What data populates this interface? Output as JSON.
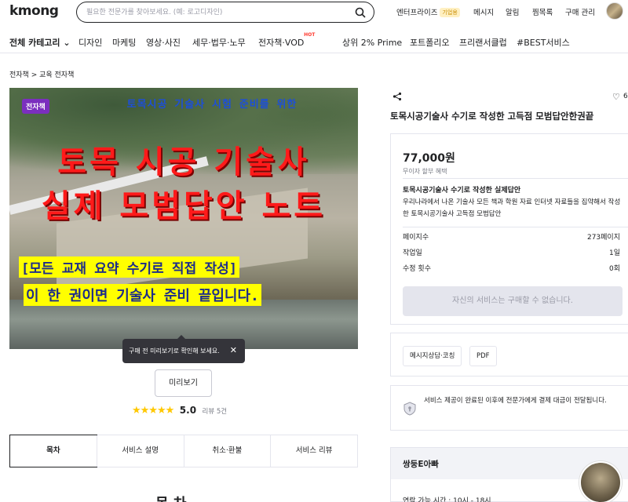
{
  "header": {
    "logo": "kmong",
    "search_placeholder": "필요한 전문가를 찾아보세요. (예: 로고디자인)",
    "menu": {
      "enterprise": "엔터프라이즈",
      "enterprise_badge": "기업용",
      "messages": "메시지",
      "notifications": "알림",
      "favorites": "찜목록",
      "purchase_manage": "구매 관리"
    }
  },
  "nav": {
    "all_categories": "전체 카테고리",
    "items": [
      "디자인",
      "마케팅",
      "영상·사진",
      "세무·법무·노무",
      "전자책·VOD",
      "상위 2% Prime",
      "포트폴리오",
      "프리랜서클럽",
      "#BEST서비스"
    ],
    "hot_label": "HOT"
  },
  "breadcrumb": "전자책 > 교육 전자책",
  "thumbnail": {
    "tag": "전자책",
    "subtitle": "토목시공 기술사 시험 준비를 위한",
    "line1": "토목 시공 기술사",
    "line2": "실제 모범답안 노트",
    "highlight1": "[모든 교재 요약 수기로 직접 작성]",
    "highlight2": "이 한 권이면 기술사 준비 끝입니다."
  },
  "tooltip": {
    "text": "구매 전 미리보기로 확인해 보세요."
  },
  "preview_button": "미리보기",
  "rating": {
    "value": "5.0",
    "count": "리뷰 5건",
    "stars": 5
  },
  "tabs": [
    "목차",
    "서비스 설명",
    "취소·환불",
    "서비스 리뷰"
  ],
  "bottom_title": "목 차",
  "product": {
    "favorites_count": "6",
    "title": "토목시공기술사 수기로 작성한 고득점 모범답안한권끝",
    "price": "77,000원",
    "benefit": "무이자 할부 혜택",
    "package_title": "토목시공기술사 수기로 작성한 실제답안",
    "package_desc": "우리나라에서 나온 기술사 모든 책과 학원 자료 인터넷 자료들을 집약해서 작성한 토목시공기술사 고득점 모범답안",
    "specs": [
      {
        "label": "페이지수",
        "value": "273페이지"
      },
      {
        "label": "작업일",
        "value": "1일"
      },
      {
        "label": "수정 횟수",
        "value": "0회"
      }
    ],
    "buy_disabled": "자신의 서비스는 구매할 수 없습니다."
  },
  "chips": [
    "메시지상담·코칭",
    "PDF"
  ],
  "notice": "서비스 제공이 완료된 이후에 전문가에게 결제 대금이 전달됩니다.",
  "seller": {
    "name": "쌍둥E아빠",
    "contact_time": "연락 가능 시간 : 10시 - 18시"
  }
}
